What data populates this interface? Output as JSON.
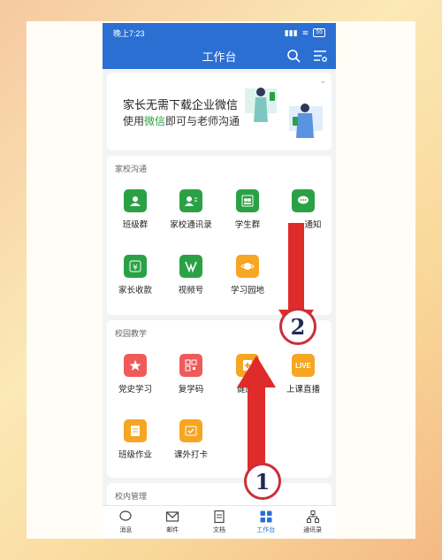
{
  "status_bar": {
    "time": "晚上7:23",
    "battery": "55"
  },
  "header": {
    "title": "工作台"
  },
  "banner": {
    "line1": "家长无需下载企业微信",
    "line2_prefix": "使用",
    "line2_highlight": "微信",
    "line2_suffix": "即可与老师沟通"
  },
  "sections": [
    {
      "title": "家校沟通",
      "apps": [
        "班级群",
        "家校通讯录",
        "学生群",
        "通知",
        "家长收款",
        "视频号",
        "学习园地"
      ]
    },
    {
      "title": "校园教学",
      "apps": [
        "党史学习",
        "复学码",
        "健康_",
        "上课直播",
        "班级作业",
        "课外打卡"
      ]
    },
    {
      "title": "校内管理"
    }
  ],
  "live_icon_text": "LIVE",
  "tabbar": [
    {
      "label": "消息",
      "icon": "chat-icon"
    },
    {
      "label": "邮件",
      "icon": "mail-icon"
    },
    {
      "label": "文档",
      "icon": "doc-icon"
    },
    {
      "label": "工作台",
      "icon": "grid-icon"
    },
    {
      "label": "通讯录",
      "icon": "contacts-icon"
    }
  ],
  "annotations": {
    "step1": "1",
    "step2": "2"
  },
  "colors": {
    "brand_blue": "#2b6fd3",
    "app_green": "#2ba145",
    "arrow_red": "#e02b2b"
  }
}
